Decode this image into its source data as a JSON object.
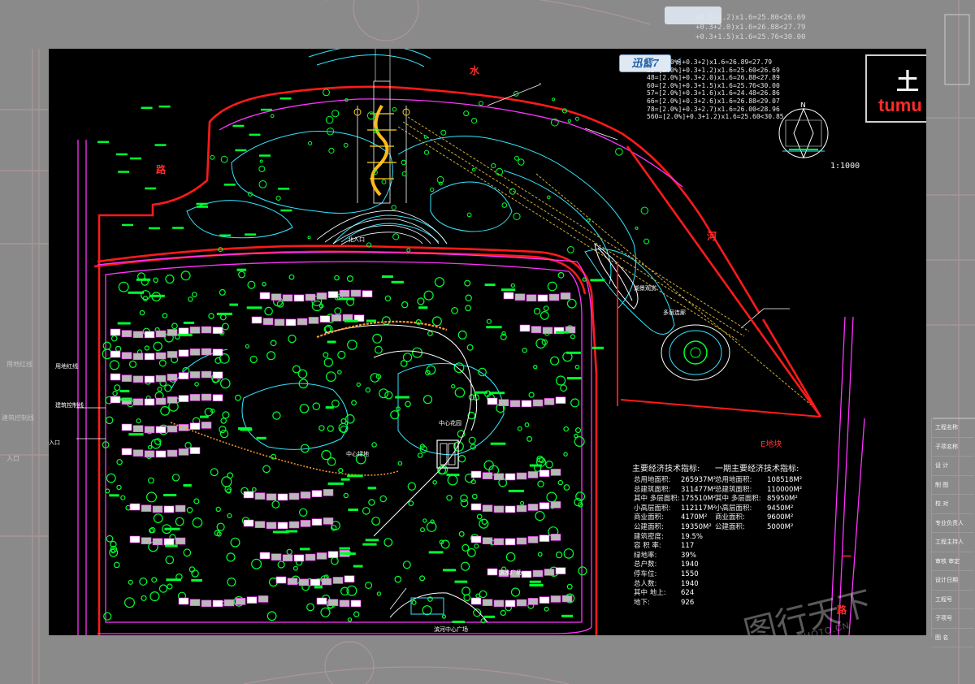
{
  "title": {
    "chinese": "土",
    "english": "tumu"
  },
  "toolbar": {
    "app_badge": "迅雷7",
    "app_badge_icon": "lightning-icon"
  },
  "elevation_notes": [
    "16=[2.0%]+0.3+2)x1.6=26.89<27.79",
    "32=[2.0%]+0.3+1.2)x1.6=25.60<26.69",
    "48=[2.0%]+0.3+2.0)x1.6=26.88<27.89",
    "60=[2.0%]+0.3+1.5)x1.6=25.76<30.00",
    "57=[2.0%]+0.3+1.6)x1.6=24.48<26.86",
    "66=[2.0%]+0.3+2.6)x1.6=26.88<29.07",
    "78=[2.0%]+0.3+2.7)x1.6=26.00<28.96",
    "560=[2.0%]+0.3+1.2)x1.6=25.60<30.85"
  ],
  "north_arrow": {
    "letter": "N"
  },
  "scale": "1:1000",
  "block_label": "E地块",
  "road_labels": [
    "水",
    "河",
    "路",
    "一",
    "路"
  ],
  "plan_labels": {
    "north_entrance": "北入口",
    "central_garden": "中心花园",
    "lake_view": "湖景观赏",
    "multi_corridor": "多层连廊",
    "waterfront_plaza": "滨水广场",
    "central_lawn": "中心绿地",
    "water_label": "水系",
    "west_entrance": "入口",
    "land_line": "用地红线",
    "building_line": "建筑控制线",
    "south_entrance": "南入口",
    "south_plaza": "滨河中心广场"
  },
  "indicators_total": {
    "title": "主要经济技术指标:",
    "rows": [
      {
        "label": "总用地面积:",
        "value": "265937M²"
      },
      {
        "label": "总建筑面积:",
        "value": "311477M²"
      },
      {
        "label": "其中 多层面积:",
        "value": "175510M²"
      },
      {
        "label": "  小高层面积:",
        "value": "112117M²"
      },
      {
        "label": "  商业面积:",
        "value": "4170M²"
      },
      {
        "label": "  公建面积:",
        "value": "19350M²"
      },
      {
        "label": "建筑密度:",
        "value": "19.5%"
      },
      {
        "label": "容 积 率:",
        "value": "117"
      },
      {
        "label": "绿地率:",
        "value": "39%"
      },
      {
        "label": "总户数:",
        "value": "1940"
      },
      {
        "label": "停车位:",
        "value": "1550"
      },
      {
        "label": "总人数:",
        "value": "1940"
      },
      {
        "label": "其中 地上:",
        "value": "624"
      },
      {
        "label": "  地下:",
        "value": "926"
      }
    ]
  },
  "indicators_phase1": {
    "title": "一期主要经济技术指标:",
    "rows": [
      {
        "label": "总用地面积:",
        "value": "108518M²"
      },
      {
        "label": "总建筑面积:",
        "value": "110000M²"
      },
      {
        "label": "其中 多层面积:",
        "value": "85950M²"
      },
      {
        "label": "  小高层面积:",
        "value": "9450M²"
      },
      {
        "label": "  商业面积:",
        "value": "9600M²"
      },
      {
        "label": "  公建面积:",
        "value": "5000M²"
      }
    ]
  },
  "title_block": [
    "工程名称",
    "子项名称",
    "设 计",
    "制 图",
    "校 对",
    "专业负责人",
    "工程主持人",
    "审核 审定",
    "设计日期",
    "工程号",
    "子项号",
    "图 名"
  ],
  "watermark": {
    "text": "图行天下",
    "sub": "PHOTOPHOTO.CN"
  },
  "colors": {
    "background": "#000000",
    "red_line": "#ff1a1a",
    "green": "#00ff30",
    "magenta": "#ff33ff",
    "cyan": "#33e6ff",
    "yellow": "#ffd21a",
    "orange": "#ff9933",
    "white": "#ffffff"
  }
}
